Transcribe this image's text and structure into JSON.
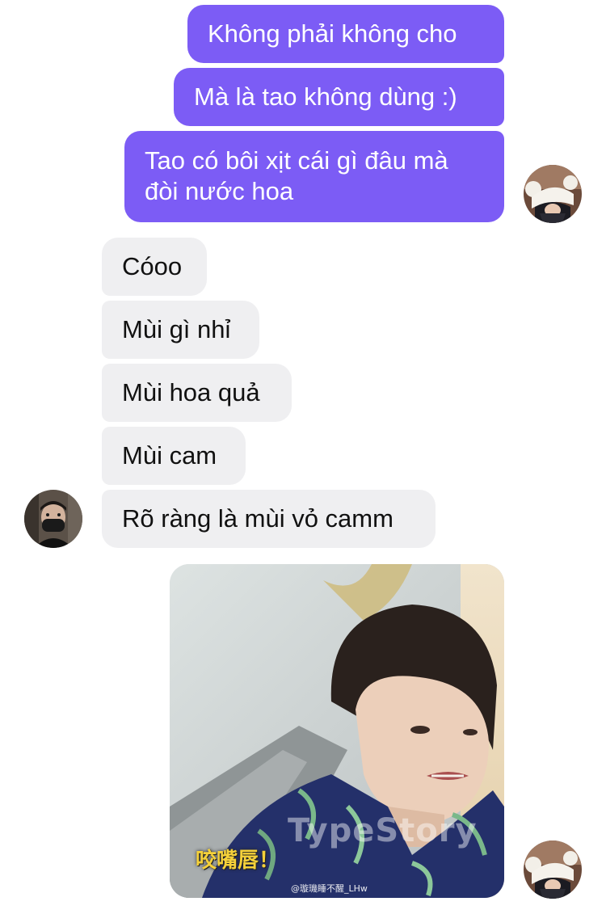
{
  "messages": {
    "outgoing": [
      "Không phải không cho",
      "Mà là tao không dùng :)",
      [
        "Tao có bôi xịt cái gì đâu mà",
        "đòi nước hoa"
      ]
    ],
    "incoming": [
      "Cóoo",
      "Mùi gì nhỉ",
      "Mùi hoa quả",
      "Mùi cam",
      "Rõ ràng là mùi vỏ camm"
    ]
  },
  "image_message": {
    "caption": "咬嘴唇！",
    "watermark": "TypeStory",
    "credit": "@璇璣睡不醒_LHw"
  },
  "colors": {
    "outgoing_bubble": "#7c5cf5",
    "incoming_bubble": "#efeff1"
  }
}
